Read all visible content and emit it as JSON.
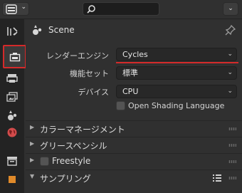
{
  "header": {
    "search": {
      "placeholder": "",
      "icon": "search-icon"
    }
  },
  "tabs": [
    {
      "name": "tool",
      "icon": "tool-icon",
      "active": false
    },
    {
      "name": "render",
      "icon": "render-icon",
      "active": true
    },
    {
      "name": "output",
      "icon": "output-icon",
      "active": false
    },
    {
      "name": "view-layer",
      "icon": "view-layer-icon",
      "active": false
    },
    {
      "name": "scene",
      "icon": "scene-icon",
      "active": false
    },
    {
      "name": "world",
      "icon": "world-icon",
      "active": false
    },
    {
      "name": "collection",
      "icon": "collection-icon",
      "active": false
    },
    {
      "name": "object",
      "icon": "object-icon",
      "active": false
    }
  ],
  "panel": {
    "title": "Scene",
    "render_engine": {
      "label": "レンダーエンジン",
      "value": "Cycles"
    },
    "feature_set": {
      "label": "機能セット",
      "value": "標準"
    },
    "device": {
      "label": "デバイス",
      "value": "CPU"
    },
    "osl": {
      "label": "Open Shading Language",
      "checked": false
    },
    "sections": [
      {
        "label": "カラーマネージメント",
        "expanded": false
      },
      {
        "label": "グリースペンシル",
        "expanded": false
      },
      {
        "label": "Freestyle",
        "expanded": false,
        "checkbox": false
      },
      {
        "label": "サンプリング",
        "expanded": true
      }
    ]
  },
  "colors": {
    "accent_red": "#d42a2a",
    "panel_bg": "#303030"
  }
}
